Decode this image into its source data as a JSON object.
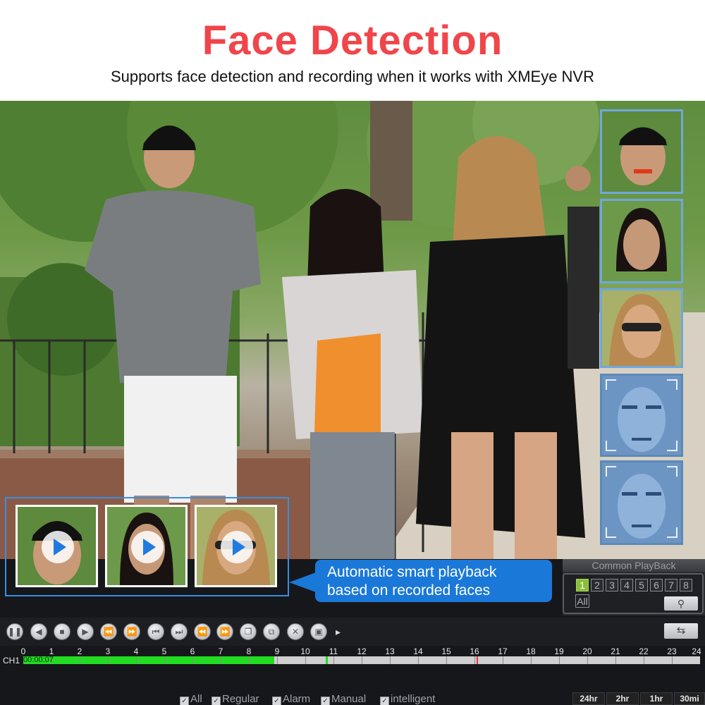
{
  "header": {
    "title": "Face Detection",
    "subtitle": "Supports face detection and recording when it works with XMEye NVR"
  },
  "callout": {
    "line1": "Automatic smart playback",
    "line2": "based on recorded faces"
  },
  "common_playback": {
    "title": "Common PlayBack",
    "channels": [
      "1",
      "2",
      "3",
      "4",
      "5",
      "6",
      "7",
      "8"
    ],
    "selected_channel": "1",
    "all_label": "All",
    "search_icon": "search-icon"
  },
  "controls": {
    "buttons": [
      "pause-icon",
      "slow-reverse-icon",
      "stop-icon",
      "play-icon",
      "fast-reverse-icon",
      "fast-forward-icon",
      "prev-frame-icon",
      "next-frame-icon",
      "prev-file-icon",
      "next-file-icon",
      "clip-icon",
      "backup-icon",
      "close-icon",
      "record-icon"
    ],
    "more_arrow": "▸",
    "sync_icon": "sync-icon"
  },
  "timeline": {
    "hours": [
      "0",
      "1",
      "2",
      "3",
      "4",
      "5",
      "6",
      "7",
      "8",
      "9",
      "10",
      "11",
      "12",
      "13",
      "14",
      "15",
      "16",
      "17",
      "18",
      "19",
      "20",
      "21",
      "22",
      "23",
      "24"
    ],
    "channel_label": "CH1",
    "current_time": "00:00:07",
    "recorded_until_hour": 8.9,
    "colors": {
      "record": "#22dd22",
      "idle": "#cfcfcf",
      "alarm": "#e23a3a"
    }
  },
  "filters": [
    {
      "label": "All",
      "checked": true
    },
    {
      "label": "Regular",
      "checked": true
    },
    {
      "label": "Alarm",
      "checked": true
    },
    {
      "label": "Manual",
      "checked": true
    },
    {
      "label": "intelligent",
      "checked": true
    }
  ],
  "zoom": [
    "24hr",
    "2hr",
    "1hr",
    "30mi"
  ],
  "colors": {
    "title_red": "#f0454a",
    "accent_blue": "#1a78d9",
    "panel_blue": "#3a8de0"
  }
}
